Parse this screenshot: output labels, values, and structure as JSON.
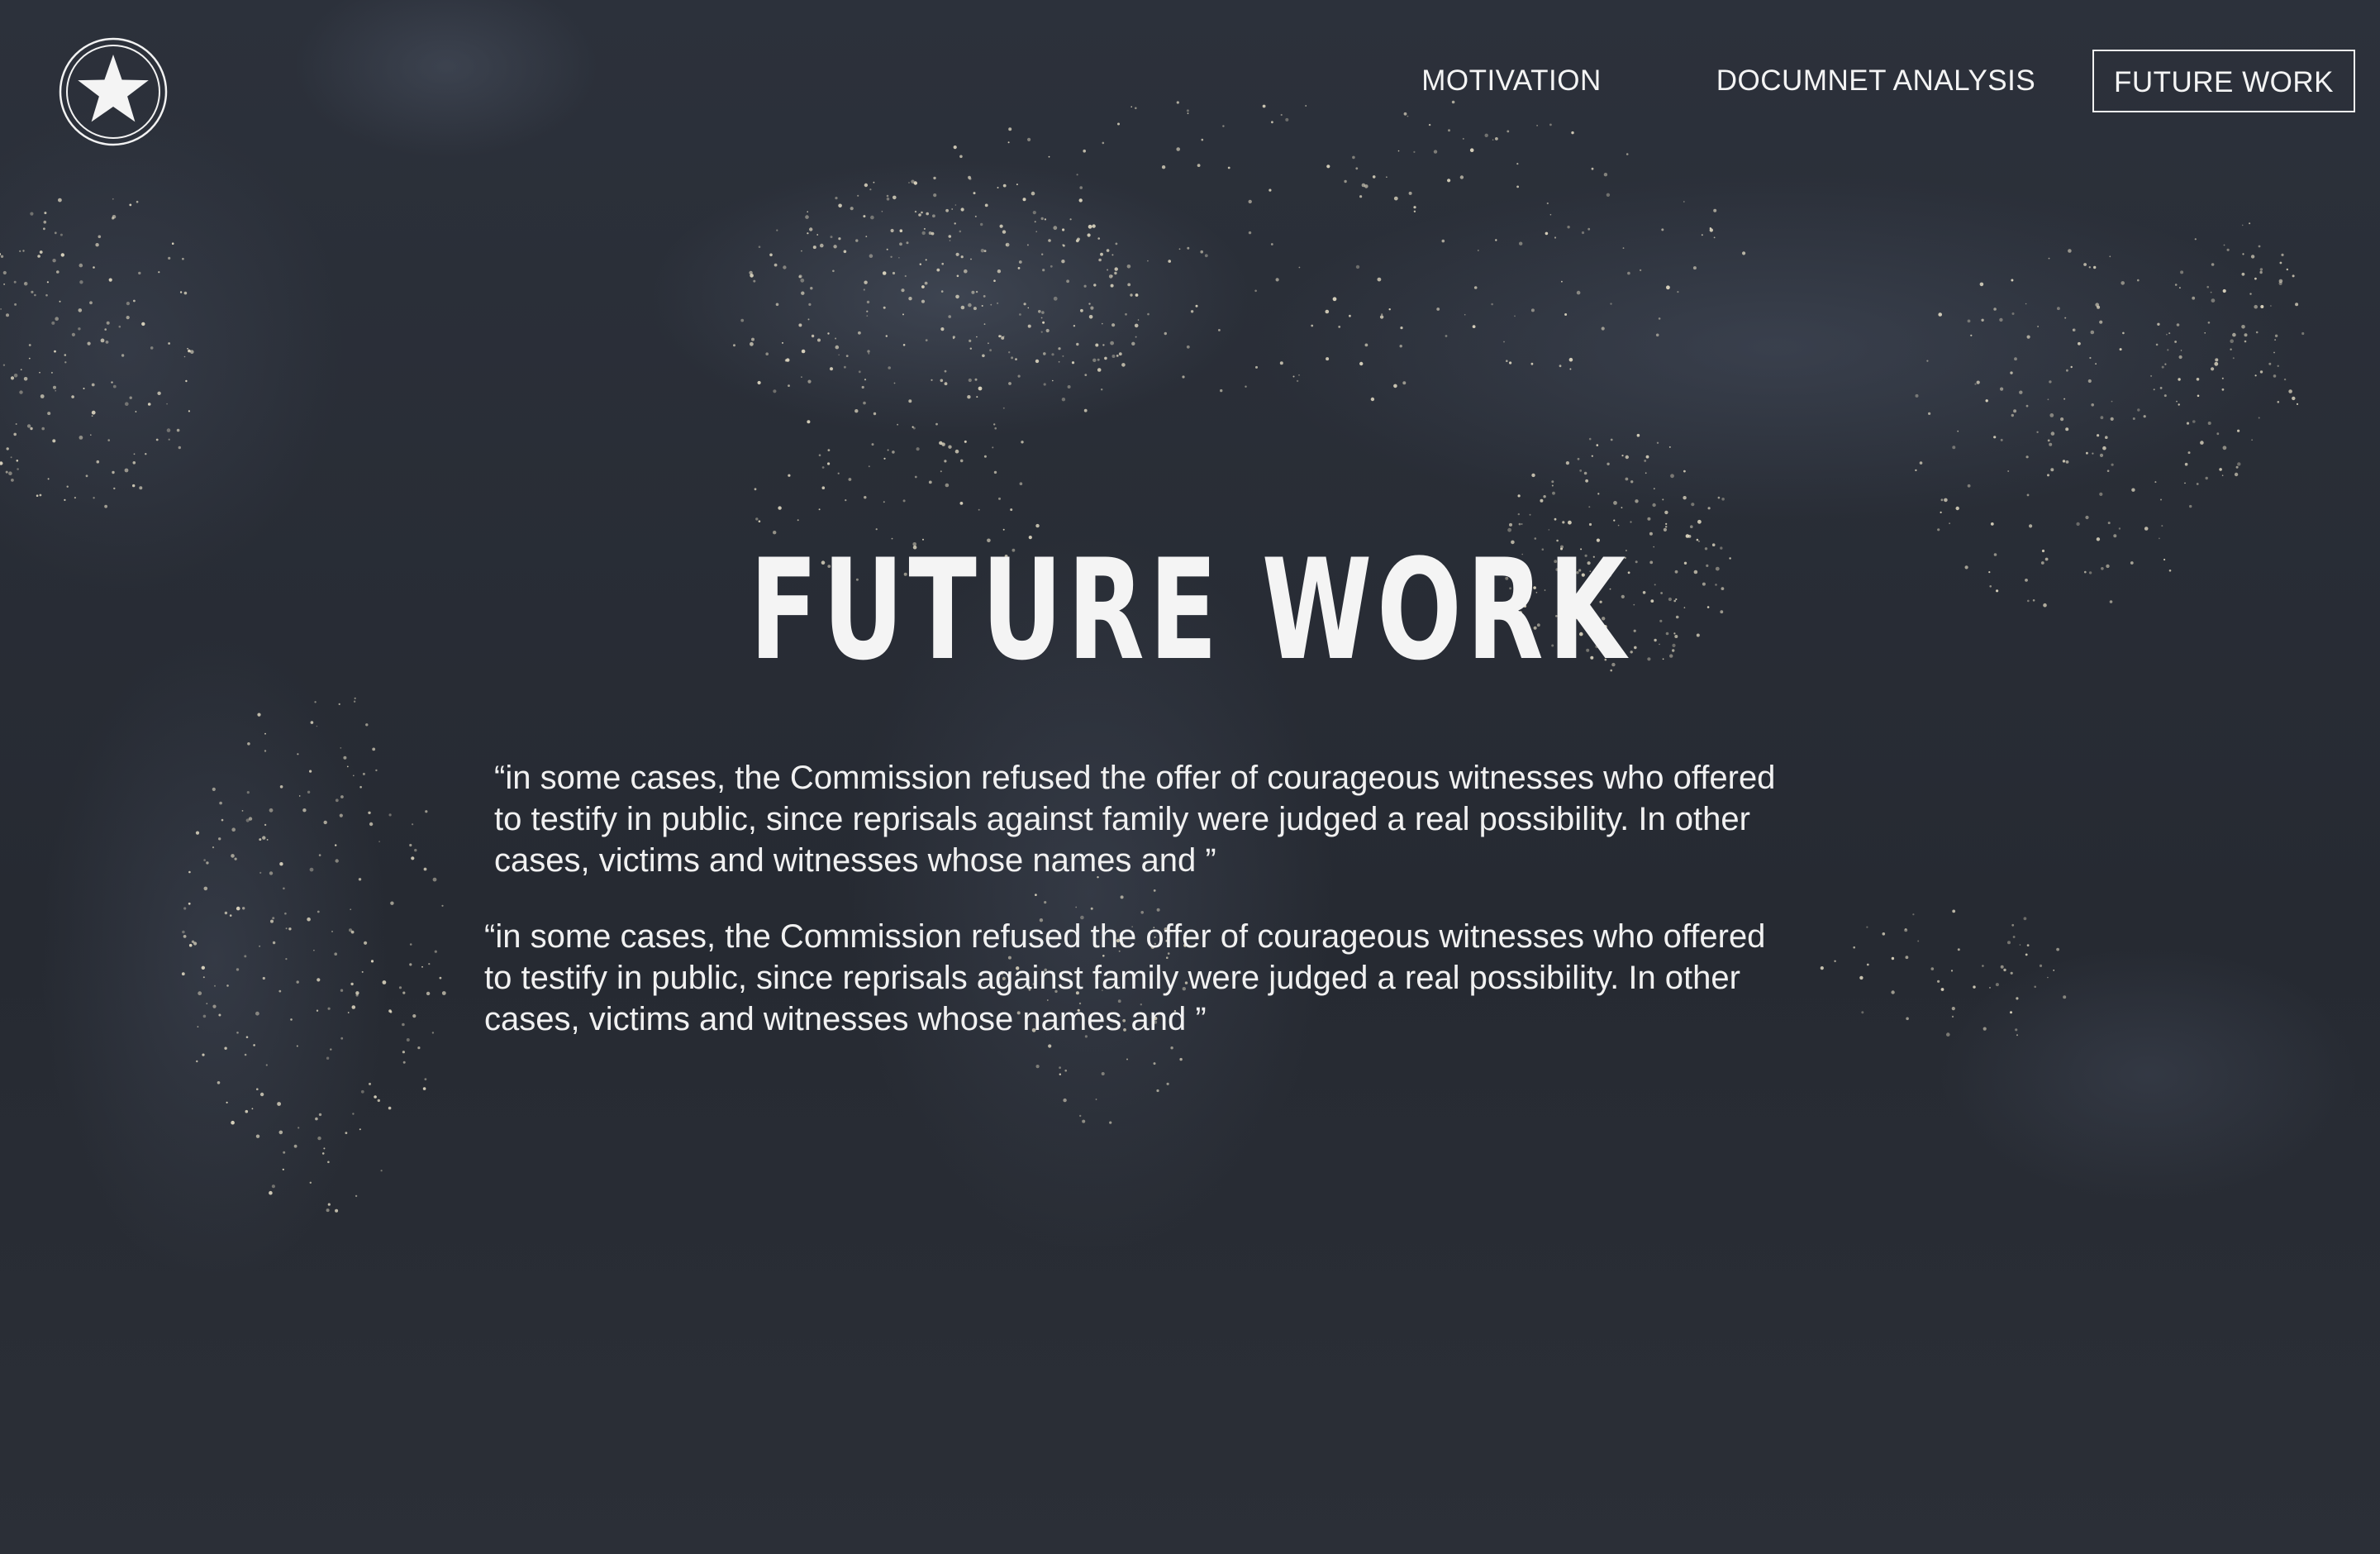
{
  "nav": {
    "items": [
      {
        "label": "MOTIVATION",
        "active": false
      },
      {
        "label": "DOCUMNET ANALYSIS",
        "active": false
      },
      {
        "label": "FUTURE WORK",
        "active": true
      }
    ]
  },
  "logo": {
    "icon": "star-icon"
  },
  "hero": {
    "title": "FUTURE WORK"
  },
  "quotes": [
    "“in some cases, the Commission refused the offer of courageous witnesses who offered\nto testify in public, since reprisals against family were judged a real possibility. In other\ncases, victims and witnesses whose names and ”",
    "“in some cases, the Commission refused the offer of courageous witnesses who offered\nto testify in public, since reprisals against family were judged a real possibility. In other\ncases, victims and witnesses whose names and ”"
  ],
  "colors": {
    "background": "#272b34",
    "text": "#f4f4f4",
    "city_lights": "#e8e0c8"
  }
}
